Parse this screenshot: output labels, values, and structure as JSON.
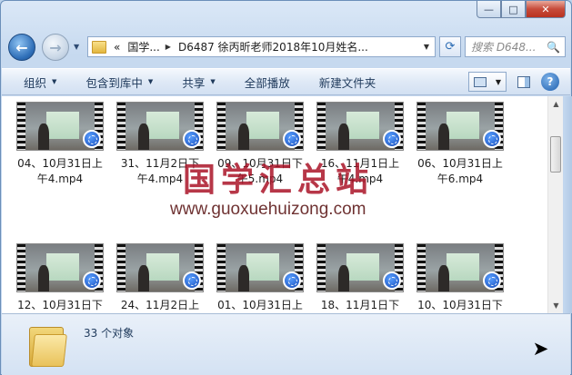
{
  "window": {
    "min_label": "—",
    "max_label": "□",
    "close_label": "✕"
  },
  "nav": {
    "back_glyph": "←",
    "forward_glyph": "→",
    "address": {
      "prefix": "«",
      "seg1": "国学...",
      "sep": "▶",
      "seg2": "D6487 徐丙昕老师2018年10月姓名..."
    },
    "refresh_glyph": "⟳",
    "search_placeholder": "搜索 D648...",
    "search_icon": "🔍"
  },
  "toolbar": {
    "organize": "组织",
    "include_library": "包含到库中",
    "share": "共享",
    "play_all": "全部播放",
    "new_folder": "新建文件夹",
    "help": "?"
  },
  "files": [
    {
      "name": "04、10月31日上午4.mp4"
    },
    {
      "name": "31、11月2日下午4.mp4"
    },
    {
      "name": "09、10月31日下午5.mp4"
    },
    {
      "name": "16、11月1日上午4.mp4"
    },
    {
      "name": "06、10月31日上午6.mp4"
    },
    {
      "name": "12、10月31日下"
    },
    {
      "name": "24、11月2日上午"
    },
    {
      "name": "01、10月31日上"
    },
    {
      "name": "18、11月1日下午"
    },
    {
      "name": "10、10月31日下"
    }
  ],
  "watermark": {
    "title": "国学汇总站",
    "url": "www.guoxuehuizong.com"
  },
  "status": {
    "count": "33 个对象"
  },
  "colors": {
    "accent": "#2f6fb8",
    "watermark": "#aa1428"
  }
}
